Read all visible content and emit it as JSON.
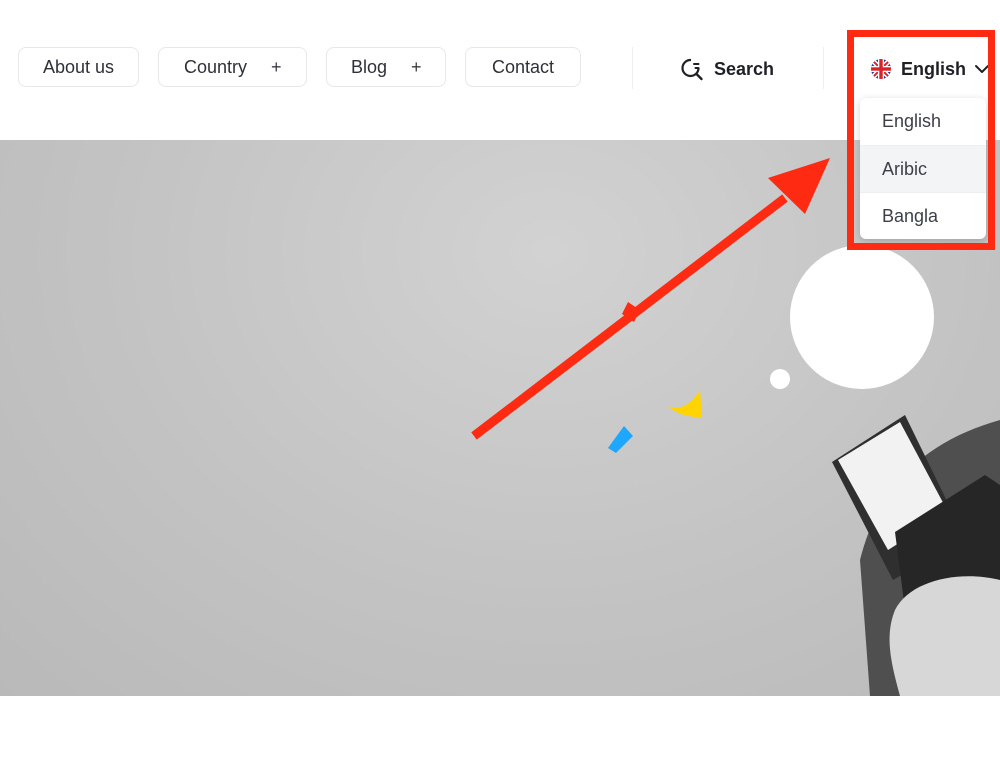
{
  "nav": {
    "items": [
      {
        "label": "About us",
        "has_plus": false
      },
      {
        "label": "Country",
        "has_plus": true
      },
      {
        "label": "Blog",
        "has_plus": true
      },
      {
        "label": "Contact",
        "has_plus": false
      }
    ],
    "plus_symbol": "+"
  },
  "search": {
    "label": "Search",
    "icon": "search-icon"
  },
  "language": {
    "selected": "English",
    "flag": "uk-flag-icon",
    "options": [
      "English",
      "Aribic",
      "Bangla"
    ],
    "hovered_option": "Aribic"
  },
  "annotation": {
    "color": "#ff2a12"
  },
  "colors": {
    "accent_yellow": "#ffd400",
    "accent_blue": "#1ea7ff"
  }
}
